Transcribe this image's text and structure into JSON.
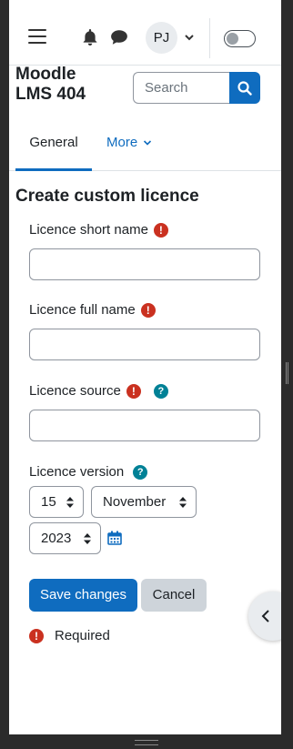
{
  "header": {
    "user_initials": "PJ",
    "site_name": "Moodle LMS 404",
    "search_placeholder": "Search"
  },
  "tabs": {
    "general": "General",
    "more": "More"
  },
  "page": {
    "title": "Create custom licence"
  },
  "form": {
    "short_name_label": "Licence short name",
    "full_name_label": "Licence full name",
    "source_label": "Licence source",
    "version_label": "Licence version",
    "version_day": "15",
    "version_month": "November",
    "version_year": "2023",
    "required_icon": "!",
    "help_icon": "?",
    "required_text": "Required"
  },
  "buttons": {
    "save": "Save changes",
    "cancel": "Cancel"
  },
  "colors": {
    "primary": "#0f6cbf",
    "required": "#ca3120",
    "help": "#008196"
  },
  "icons": [
    "menu-icon",
    "bell-icon",
    "chat-icon",
    "chevron-down-icon",
    "search-icon",
    "calendar-icon",
    "chevron-left-icon"
  ]
}
